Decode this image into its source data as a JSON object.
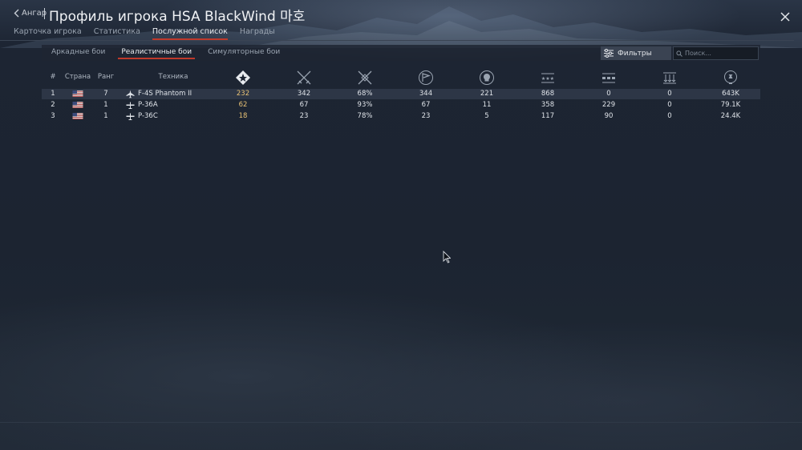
{
  "header": {
    "back_label": "Ангар",
    "title": "Профиль игрока HSA BlackWind 마호"
  },
  "main_tabs": [
    {
      "label": "Карточка игрока"
    },
    {
      "label": "Статистика"
    },
    {
      "label": "Послужной список"
    },
    {
      "label": "Награды"
    }
  ],
  "sub_tabs": [
    {
      "label": "Аркадные бои"
    },
    {
      "label": "Реалистичные бои"
    },
    {
      "label": "Симуляторные бои"
    }
  ],
  "filters_label": "Фильтры",
  "search_placeholder": "Поиск...",
  "table": {
    "headers": {
      "index": "#",
      "country": "Страна",
      "rank": "Ранг",
      "vehicle": "Техника"
    },
    "icon_columns": [
      "battles-icon",
      "victories-icon",
      "win-rate-icon",
      "flag-icon",
      "deaths-icon",
      "air-kills-icon",
      "ground-kills-icon",
      "naval-kills-icon",
      "lions-icon"
    ],
    "rows": [
      {
        "index": "1",
        "country": "USA",
        "rank": "7",
        "vehicle": "F-4S Phantom II",
        "vehicle_type": "jet-icon",
        "c1": "232",
        "c2": "342",
        "c3": "68%",
        "c4": "344",
        "c5": "221",
        "c6": "868",
        "c7": "0",
        "c8": "0",
        "c9": "643K"
      },
      {
        "index": "2",
        "country": "USA",
        "rank": "1",
        "vehicle": "P-36A",
        "vehicle_type": "prop-fighter-icon",
        "c1": "62",
        "c2": "67",
        "c3": "93%",
        "c4": "67",
        "c5": "11",
        "c6": "358",
        "c7": "229",
        "c8": "0",
        "c9": "79.1K"
      },
      {
        "index": "3",
        "country": "USA",
        "rank": "1",
        "vehicle": "P-36C",
        "vehicle_type": "prop-fighter-icon",
        "c1": "18",
        "c2": "23",
        "c3": "78%",
        "c4": "23",
        "c5": "5",
        "c6": "117",
        "c7": "90",
        "c8": "0",
        "c9": "24.4K"
      }
    ]
  },
  "colors": {
    "accent_red": "#c0392b",
    "highlight_gold": "#e6c074"
  }
}
